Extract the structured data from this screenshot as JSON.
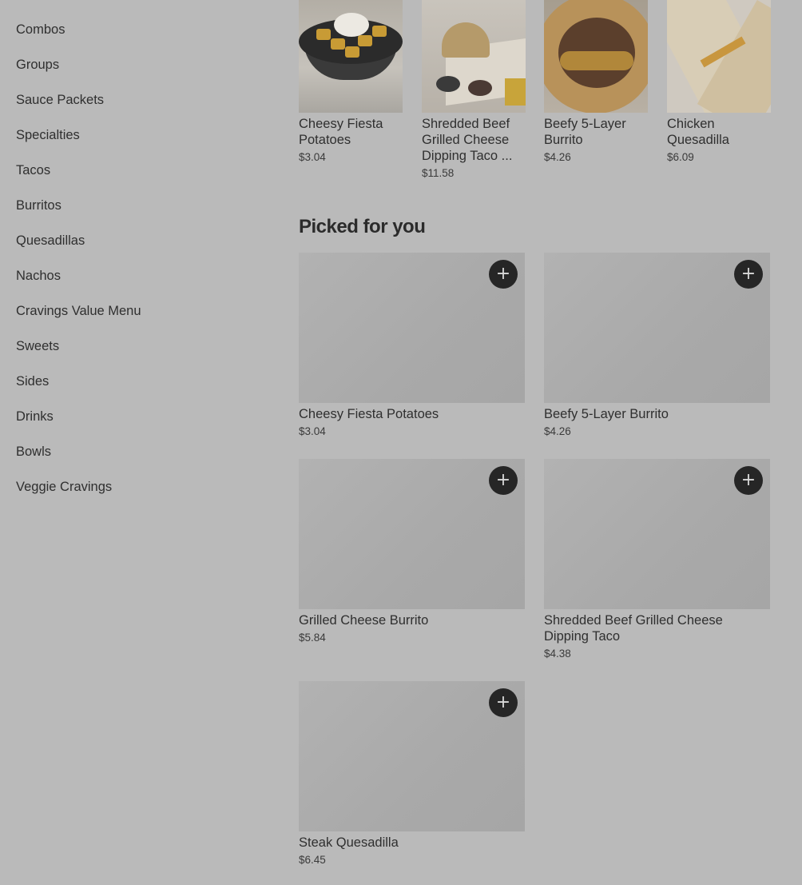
{
  "sidebar": {
    "items": [
      {
        "label": "Combos"
      },
      {
        "label": "Groups"
      },
      {
        "label": "Sauce Packets"
      },
      {
        "label": "Specialties"
      },
      {
        "label": "Tacos"
      },
      {
        "label": "Burritos"
      },
      {
        "label": "Quesadillas"
      },
      {
        "label": "Nachos"
      },
      {
        "label": "Cravings Value Menu"
      },
      {
        "label": "Sweets"
      },
      {
        "label": "Sides"
      },
      {
        "label": "Drinks"
      },
      {
        "label": "Bowls"
      },
      {
        "label": "Veggie Cravings"
      }
    ]
  },
  "featured": {
    "items": [
      {
        "name": "Cheesy Fiesta Potatoes",
        "price": "$3.04"
      },
      {
        "name": "Shredded Beef Grilled Cheese Dipping Taco ...",
        "price": "$11.58"
      },
      {
        "name": "Beefy 5-Layer Burrito",
        "price": "$4.26"
      },
      {
        "name": "Chicken Quesadilla",
        "price": "$6.09"
      }
    ]
  },
  "picked": {
    "title": "Picked for you",
    "add_label": "+",
    "items": [
      {
        "name": "Cheesy Fiesta Potatoes",
        "price": "$3.04"
      },
      {
        "name": "Beefy 5-Layer Burrito",
        "price": "$4.26"
      },
      {
        "name": "Grilled Cheese Burrito",
        "price": "$5.84"
      },
      {
        "name": "Shredded Beef Grilled Cheese Dipping Taco",
        "price": "$4.38"
      },
      {
        "name": "Steak Quesadilla",
        "price": "$6.45"
      }
    ]
  },
  "colors": {
    "overlay_background": "#bababa",
    "add_button": "#262626",
    "text": "#2f2f2f"
  }
}
